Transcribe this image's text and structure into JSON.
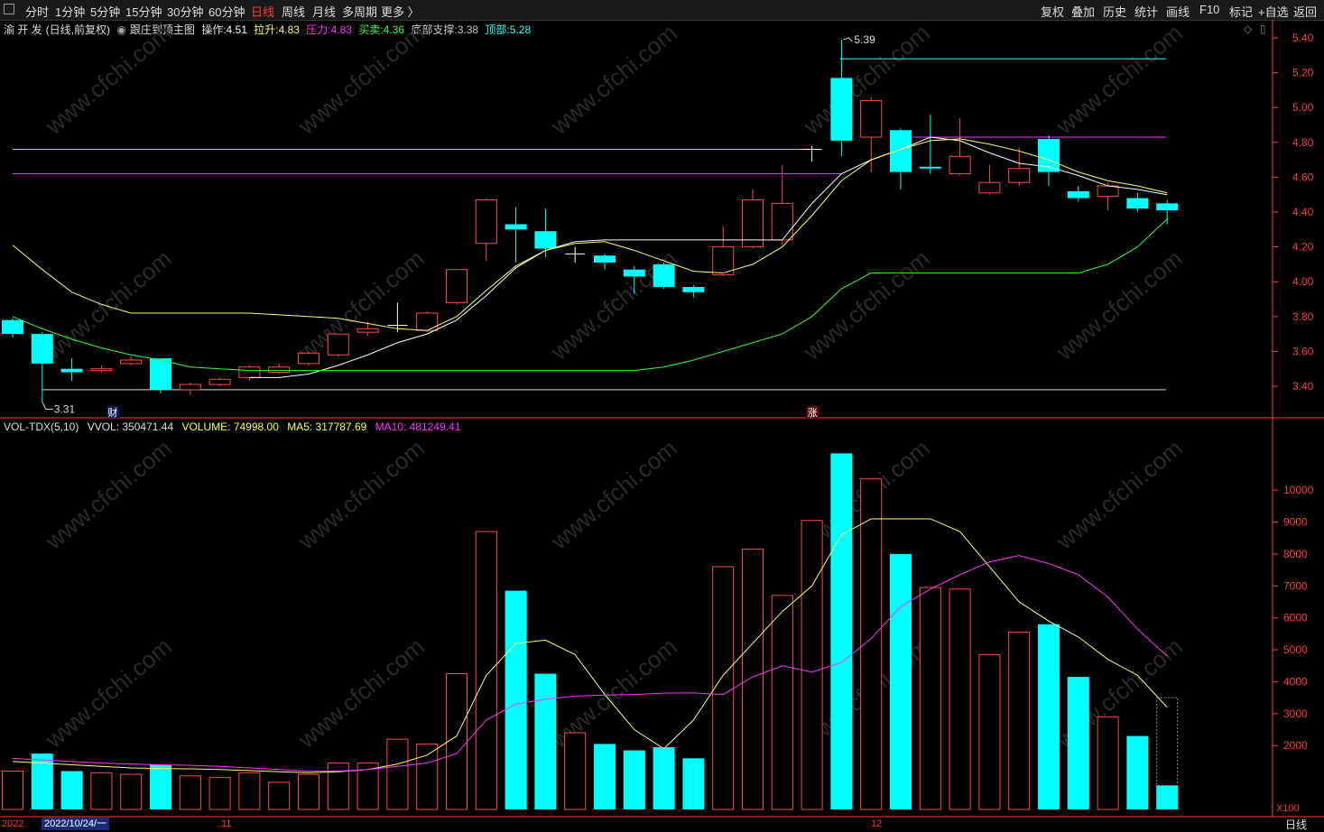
{
  "toolbar": {
    "periods": [
      "分时",
      "1分钟",
      "5分钟",
      "15分钟",
      "30分钟",
      "60分钟",
      "日线",
      "周线",
      "月线",
      "多周期",
      "更多 〉"
    ],
    "active_period": "日线",
    "right_buttons": [
      "复权",
      "叠加",
      "历史",
      "统计",
      "画线",
      "F10",
      "标记",
      "+自选",
      "返回"
    ]
  },
  "indicator_line": {
    "stock_name": "渝 开 发",
    "mode": "(日线,前复权)",
    "indicator_name": "跟庄到顶主图",
    "op_label": "操作:",
    "op_value": "4.51",
    "lift_label": "拉升:",
    "lift_value": "4.83",
    "pressure_label": "压力:",
    "pressure_value": "4.83",
    "trade_label": "买卖:",
    "trade_value": "4.36",
    "support_label": "底部支撑:",
    "support_value": "3.38",
    "top_label": "顶部:",
    "top_value": "5.28"
  },
  "volume_line": {
    "name": "VOL-TDX(5,10)",
    "vvol": "VVOL: 350471.44",
    "volume": "VOLUME: 74998.00",
    "ma5": "MA5: 317787.69",
    "ma10": "MA10: 481249.41"
  },
  "colors": {
    "up": "#ff4b4b",
    "down": "#00ffff",
    "ma_yellow": "#ffff66",
    "ma_magenta": "#ff33ff",
    "ma_green": "#33ff33",
    "white_line": "#ffffff",
    "axis": "#ff3b3b"
  },
  "bottom": {
    "year": "2022",
    "date_box": "2022/10/24/一",
    "m11": "11",
    "m12": "12",
    "period_label": "日线"
  },
  "markers": {
    "cai": "财",
    "zhang": "涨",
    "high_label": "5.39",
    "low_label": "3.31",
    "x100": "X100"
  },
  "chart_data": [
    {
      "type": "candlestick",
      "y_ticks": [
        "5.40",
        "5.20",
        "5.00",
        "4.80",
        "4.60",
        "4.40",
        "4.20",
        "4.00",
        "3.80",
        "3.60",
        "3.40"
      ],
      "ylim": [
        3.31,
        5.45
      ],
      "candles": [
        {
          "o": 3.78,
          "c": 3.7,
          "h": 3.79,
          "l": 3.68
        },
        {
          "o": 3.7,
          "c": 3.53,
          "h": 3.71,
          "l": 3.31
        },
        {
          "o": 3.5,
          "c": 3.48,
          "h": 3.56,
          "l": 3.43
        },
        {
          "o": 3.49,
          "c": 3.5,
          "h": 3.52,
          "l": 3.48
        },
        {
          "o": 3.53,
          "c": 3.55,
          "h": 3.57,
          "l": 3.52
        },
        {
          "o": 3.56,
          "c": 3.38,
          "h": 3.56,
          "l": 3.36
        },
        {
          "o": 3.38,
          "c": 3.41,
          "h": 3.42,
          "l": 3.35
        },
        {
          "o": 3.41,
          "c": 3.44,
          "h": 3.45,
          "l": 3.4
        },
        {
          "o": 3.45,
          "c": 3.51,
          "h": 3.52,
          "l": 3.43
        },
        {
          "o": 3.48,
          "c": 3.51,
          "h": 3.53,
          "l": 3.47
        },
        {
          "o": 3.53,
          "c": 3.59,
          "h": 3.6,
          "l": 3.52
        },
        {
          "o": 3.58,
          "c": 3.7,
          "h": 3.7,
          "l": 3.57
        },
        {
          "o": 3.71,
          "c": 3.73,
          "h": 3.77,
          "l": 3.69
        },
        {
          "o": 3.75,
          "c": 3.75,
          "h": 3.88,
          "l": 3.71
        },
        {
          "o": 3.72,
          "c": 3.82,
          "h": 3.83,
          "l": 3.71
        },
        {
          "o": 3.88,
          "c": 4.07,
          "h": 4.07,
          "l": 3.87
        },
        {
          "o": 4.22,
          "c": 4.47,
          "h": 4.48,
          "l": 4.12
        },
        {
          "o": 4.33,
          "c": 4.3,
          "h": 4.43,
          "l": 4.11
        },
        {
          "o": 4.29,
          "c": 4.19,
          "h": 4.42,
          "l": 4.14
        },
        {
          "o": 4.16,
          "c": 4.16,
          "h": 4.2,
          "l": 4.11
        },
        {
          "o": 4.15,
          "c": 4.11,
          "h": 4.16,
          "l": 4.07
        },
        {
          "o": 4.07,
          "c": 4.03,
          "h": 4.09,
          "l": 3.93
        },
        {
          "o": 4.1,
          "c": 3.97,
          "h": 4.11,
          "l": 3.96
        },
        {
          "o": 3.97,
          "c": 3.94,
          "h": 3.98,
          "l": 3.91
        },
        {
          "o": 4.04,
          "c": 4.2,
          "h": 4.32,
          "l": 4.03
        },
        {
          "o": 4.2,
          "c": 4.47,
          "h": 4.53,
          "l": 4.19
        },
        {
          "o": 4.24,
          "c": 4.45,
          "h": 4.67,
          "l": 4.21
        },
        {
          "o": 4.76,
          "c": 4.76,
          "h": 4.78,
          "l": 4.69
        },
        {
          "o": 5.17,
          "c": 4.81,
          "h": 5.39,
          "l": 4.72
        },
        {
          "o": 4.83,
          "c": 5.04,
          "h": 5.06,
          "l": 4.63
        },
        {
          "o": 4.87,
          "c": 4.63,
          "h": 4.88,
          "l": 4.53
        },
        {
          "o": 4.66,
          "c": 4.65,
          "h": 4.96,
          "l": 4.62
        },
        {
          "o": 4.62,
          "c": 4.72,
          "h": 4.94,
          "l": 4.61
        },
        {
          "o": 4.51,
          "c": 4.57,
          "h": 4.67,
          "l": 4.5
        },
        {
          "o": 4.57,
          "c": 4.65,
          "h": 4.77,
          "l": 4.55
        },
        {
          "o": 4.82,
          "c": 4.63,
          "h": 4.84,
          "l": 4.55
        },
        {
          "o": 4.52,
          "c": 4.48,
          "h": 4.55,
          "l": 4.46
        },
        {
          "o": 4.49,
          "c": 4.55,
          "h": 4.57,
          "l": 4.41
        },
        {
          "o": 4.48,
          "c": 4.42,
          "h": 4.51,
          "l": 4.4
        },
        {
          "o": 4.45,
          "c": 4.41,
          "h": 4.47,
          "l": 4.33
        }
      ],
      "lines": {
        "top": {
          "value": 5.28,
          "from": 28
        },
        "cyan_level": {
          "value": 4.76,
          "to": 27
        },
        "magenta_level": {
          "value": 4.62,
          "to": 28
        },
        "magenta_later": {
          "value": 4.83,
          "from": 30
        },
        "bottom_level": {
          "value": 3.38,
          "from": 1
        },
        "white_ma": [
          null,
          null,
          null,
          null,
          null,
          null,
          null,
          null,
          3.45,
          3.45,
          3.47,
          3.52,
          3.58,
          3.65,
          3.7,
          3.78,
          3.92,
          4.08,
          4.18,
          4.23,
          4.24,
          4.24,
          4.24,
          4.24,
          4.24,
          4.24,
          4.24,
          4.45,
          4.62,
          4.7,
          4.76,
          4.83,
          4.81,
          4.74,
          4.68,
          4.66,
          4.61,
          4.55,
          4.53,
          4.5
        ],
        "yellow_ma": [
          4.21,
          4.07,
          3.94,
          3.87,
          3.82,
          3.82,
          3.82,
          3.82,
          3.82,
          3.81,
          3.8,
          3.79,
          3.76,
          3.73,
          3.72,
          3.8,
          3.95,
          4.09,
          4.18,
          4.22,
          4.23,
          4.18,
          4.12,
          4.06,
          4.05,
          4.1,
          4.2,
          4.38,
          4.58,
          4.7,
          4.76,
          4.81,
          4.82,
          4.79,
          4.75,
          4.7,
          4.63,
          4.58,
          4.55,
          4.51
        ],
        "green_ma": [
          3.8,
          3.73,
          3.67,
          3.62,
          3.58,
          3.55,
          3.51,
          3.5,
          3.49,
          3.49,
          3.49,
          3.49,
          3.49,
          3.49,
          3.49,
          3.49,
          3.49,
          3.49,
          3.49,
          3.49,
          3.49,
          3.49,
          3.51,
          3.55,
          3.6,
          3.65,
          3.7,
          3.8,
          3.96,
          4.05,
          4.05,
          4.05,
          4.05,
          4.05,
          4.05,
          4.05,
          4.05,
          4.1,
          4.2,
          4.36
        ]
      }
    },
    {
      "type": "bar",
      "series_name": "VOLUME",
      "y_ticks": [
        "10000",
        "9000",
        "8000",
        "7000",
        "6000",
        "5000",
        "4000",
        "3000",
        "2000"
      ],
      "unit_label": "X100",
      "ylim": [
        0,
        11500
      ],
      "values": [
        1200,
        1750,
        1200,
        1150,
        1100,
        1400,
        1050,
        1000,
        1150,
        850,
        1100,
        1450,
        1450,
        2200,
        2050,
        4250,
        8700,
        6850,
        4250,
        2400,
        2050,
        1850,
        1950,
        1600,
        7600,
        8150,
        6700,
        9050,
        11150,
        10350,
        8000,
        6950,
        6900,
        4850,
        5550,
        5800,
        4150,
        2900,
        2300,
        750
      ],
      "up": [
        true,
        false,
        false,
        true,
        true,
        false,
        true,
        true,
        true,
        true,
        true,
        true,
        true,
        true,
        true,
        true,
        true,
        false,
        false,
        true,
        false,
        false,
        false,
        false,
        true,
        true,
        true,
        true,
        false,
        true,
        false,
        true,
        true,
        true,
        true,
        false,
        false,
        true,
        false,
        false
      ],
      "ma5": [
        1500,
        1450,
        1400,
        1350,
        1300,
        1280,
        1270,
        1250,
        1220,
        1180,
        1150,
        1180,
        1250,
        1420,
        1700,
        2300,
        4200,
        5200,
        5300,
        4850,
        3600,
        2500,
        1900,
        2800,
        4200,
        5200,
        6200,
        7000,
        8600,
        9100,
        9100,
        9100,
        8700,
        7600,
        6500,
        5900,
        5400,
        4700,
        4200,
        3200
      ],
      "ma10": [
        1600,
        1550,
        1500,
        1450,
        1420,
        1400,
        1380,
        1350,
        1300,
        1250,
        1200,
        1200,
        1250,
        1350,
        1450,
        1750,
        2800,
        3300,
        3450,
        3550,
        3580,
        3600,
        3640,
        3650,
        3600,
        4150,
        4500,
        4300,
        4600,
        5350,
        6350,
        6900,
        7350,
        7750,
        7950,
        7700,
        7350,
        6650,
        5650,
        4800
      ],
      "last_hollow_top": 3500
    }
  ]
}
